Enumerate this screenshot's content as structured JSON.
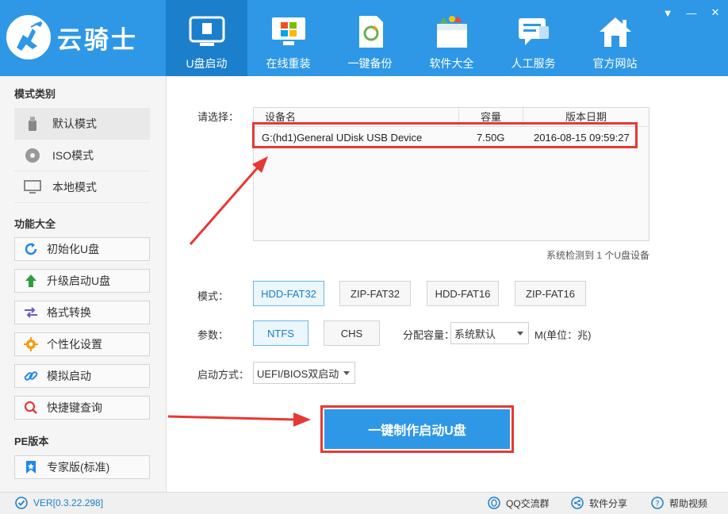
{
  "app": {
    "name": "云骑士",
    "nav": [
      {
        "label": "U盘启动",
        "icon": "usb-drive-icon",
        "active": true
      },
      {
        "label": "在线重装",
        "icon": "windows-monitor-icon"
      },
      {
        "label": "一键备份",
        "icon": "backup-document-icon"
      },
      {
        "label": "软件大全",
        "icon": "software-box-icon"
      },
      {
        "label": "人工服务",
        "icon": "chat-bubble-icon"
      },
      {
        "label": "官方网站",
        "icon": "house-icon"
      }
    ],
    "window_controls": [
      "▼",
      "—",
      "✕"
    ]
  },
  "sidebar": {
    "mode_title": "模式类别",
    "modes": [
      {
        "label": "默认模式",
        "icon": "usb-drive-icon",
        "selected": true
      },
      {
        "label": "ISO模式",
        "icon": "disc-icon"
      },
      {
        "label": "本地模式",
        "icon": "monitor-icon"
      }
    ],
    "func_title": "功能大全",
    "functions": [
      {
        "label": "初始化U盘",
        "icon": "refresh-icon"
      },
      {
        "label": "升级启动U盘",
        "icon": "upgrade-arrow-icon"
      },
      {
        "label": "格式转换",
        "icon": "swap-arrows-icon"
      },
      {
        "label": "个性化设置",
        "icon": "gear-icon"
      },
      {
        "label": "模拟启动",
        "icon": "link-icon"
      },
      {
        "label": "快捷键查询",
        "icon": "search-icon"
      }
    ],
    "pe_title": "PE版本",
    "pe_items": [
      {
        "label": "专家版(标准)",
        "icon": "bookmark-icon"
      }
    ]
  },
  "main": {
    "select_label": "请选择：",
    "table": {
      "headers": [
        "设备名",
        "容量",
        "版本日期"
      ],
      "rows": [
        {
          "device": "G:(hd1)General UDisk USB Device",
          "capacity": "7.50G",
          "date": "2016-08-15 09:59:27"
        }
      ]
    },
    "detect_text": "系统检测到 1 个U盘设备",
    "mode_label": "模式：",
    "modes": [
      {
        "label": "HDD-FAT32",
        "active": true
      },
      {
        "label": "ZIP-FAT32"
      },
      {
        "label": "HDD-FAT16"
      },
      {
        "label": "ZIP-FAT16"
      }
    ],
    "param_label": "参数：",
    "params": [
      {
        "label": "NTFS",
        "active": true
      },
      {
        "label": "CHS"
      }
    ],
    "alloc_label": "分配容量：",
    "alloc_value": "系统默认",
    "alloc_unit": "M(单位：兆)",
    "boot_label": "启动方式：",
    "boot_value": "UEFI/BIOS双启动",
    "cta_label": "一键制作启动U盘"
  },
  "footer": {
    "version": "VER[0.3.22.298]",
    "links": [
      {
        "label": "QQ交流群",
        "icon": "qq-icon"
      },
      {
        "label": "软件分享",
        "icon": "share-icon"
      },
      {
        "label": "帮助视频",
        "icon": "help-icon"
      }
    ]
  },
  "colors": {
    "brand": "#2e98e6",
    "nav_active": "#1b7fcc",
    "highlight": "#e53935",
    "selected_option": "#1a7fc9"
  }
}
